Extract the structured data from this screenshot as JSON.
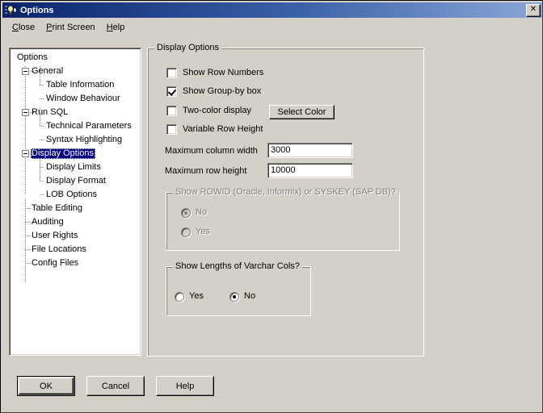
{
  "window": {
    "title": "Options",
    "icon": "lightbulb-icon",
    "close_label": "✕",
    "bg_color": "#d4d0c8",
    "titlebar_color": "#0a246a"
  },
  "menubar": {
    "items": [
      {
        "label": "Close",
        "accel": "C"
      },
      {
        "label": "Print Screen",
        "accel": "P"
      },
      {
        "label": "Help",
        "accel": "H"
      }
    ]
  },
  "tree": {
    "root_label": "Options",
    "selected": "Display Options",
    "selection_color": "#000080",
    "nodes": [
      {
        "label": "Options",
        "level": 0,
        "expander": "none"
      },
      {
        "label": "General",
        "level": 1,
        "expander": "minus"
      },
      {
        "label": "Table Information",
        "level": 2,
        "expander": "none"
      },
      {
        "label": "Window Behaviour",
        "level": 2,
        "expander": "none"
      },
      {
        "label": "Run SQL",
        "level": 1,
        "expander": "minus"
      },
      {
        "label": "Technical Parameters",
        "level": 2,
        "expander": "none"
      },
      {
        "label": "Syntax Highlighting",
        "level": 2,
        "expander": "none"
      },
      {
        "label": "Display Options",
        "level": 1,
        "expander": "minus"
      },
      {
        "label": "Display Limits",
        "level": 2,
        "expander": "none"
      },
      {
        "label": "Display Format",
        "level": 2,
        "expander": "none"
      },
      {
        "label": "LOB Options",
        "level": 2,
        "expander": "none"
      },
      {
        "label": "Table Editing",
        "level": 1,
        "expander": "none"
      },
      {
        "label": "Auditing",
        "level": 1,
        "expander": "none"
      },
      {
        "label": "User Rights",
        "level": 1,
        "expander": "none"
      },
      {
        "label": "File Locations",
        "level": 1,
        "expander": "none"
      },
      {
        "label": "Config Files",
        "level": 1,
        "expander": "none"
      }
    ]
  },
  "display_options": {
    "title": "Display Options",
    "checkboxes": [
      {
        "label": "Show Row Numbers",
        "checked": false
      },
      {
        "label": "Show Group-by box",
        "checked": true
      },
      {
        "label": "Two-color display",
        "checked": false
      },
      {
        "label": "Variable Row Height",
        "checked": false
      }
    ],
    "select_color_button": "Select Color",
    "fields": [
      {
        "label": "Maximum column width",
        "value": "3000"
      },
      {
        "label": "Maximum row height",
        "value": "10000"
      }
    ],
    "rowid_group": {
      "title": "Show ROWID (Oracle, Informix) or SYSKEY (SAP DB)?",
      "disabled": true,
      "options": [
        {
          "label": "No",
          "selected": true
        },
        {
          "label": "Yes",
          "selected": false
        }
      ]
    },
    "varchar_group": {
      "title": "Show Lengths of Varchar Cols?",
      "disabled": false,
      "options": [
        {
          "label": "Yes",
          "selected": false
        },
        {
          "label": "No",
          "selected": true
        }
      ]
    }
  },
  "footer": {
    "buttons": [
      {
        "label": "OK",
        "default": true
      },
      {
        "label": "Cancel",
        "default": false
      },
      {
        "label": "Help",
        "default": false
      }
    ]
  }
}
